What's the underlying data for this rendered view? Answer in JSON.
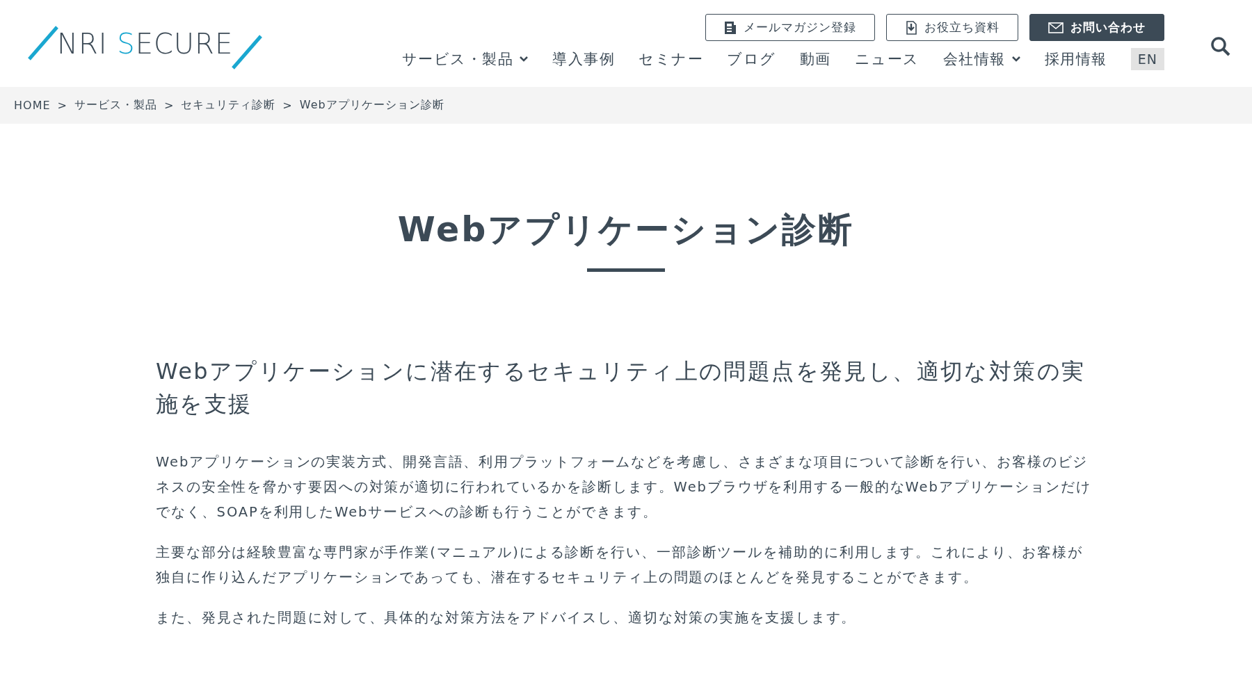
{
  "logo": {
    "parts": [
      {
        "text": "NRI ",
        "accent": false
      },
      {
        "text": "S",
        "accent": true
      },
      {
        "text": "ECURE",
        "accent": false
      }
    ]
  },
  "top_buttons": [
    {
      "label": "メールマガジン登録",
      "kind": "outline"
    },
    {
      "label": "お役立ち資料",
      "kind": "outline"
    },
    {
      "label": "お問い合わせ",
      "kind": "filled"
    }
  ],
  "nav": [
    {
      "label": "サービス・製品",
      "has_menu": true,
      "kind": "link"
    },
    {
      "label": "導入事例",
      "has_menu": false,
      "kind": "link"
    },
    {
      "label": "セミナー",
      "has_menu": false,
      "kind": "link"
    },
    {
      "label": "ブログ",
      "has_menu": false,
      "kind": "link"
    },
    {
      "label": "動画",
      "has_menu": false,
      "kind": "link"
    },
    {
      "label": "ニュース",
      "has_menu": false,
      "kind": "link"
    },
    {
      "label": "会社情報",
      "has_menu": true,
      "kind": "link"
    },
    {
      "label": "採用情報",
      "has_menu": false,
      "kind": "link"
    }
  ],
  "language": {
    "label": "EN"
  },
  "breadcrumb": {
    "links": [
      {
        "label": "HOME",
        "separator": ">"
      },
      {
        "label": "サービス・製品",
        "separator": ">"
      },
      {
        "label": "セキュリティ診断",
        "separator": ">"
      }
    ],
    "current": "Webアプリケーション診断"
  },
  "page_title": "Webアプリケーション診断",
  "lead": "Webアプリケーションに潜在するセキュリティ上の問題点を発見し、適切な対策の実施を支援",
  "paragraphs": [
    "Webアプリケーションの実装方式、開発言語、利用プラットフォームなどを考慮し、さまざまな項目について診断を行い、お客様のビジネスの安全性を脅かす要因への対策が適切に行われているかを診断します。Webブラウザを利用する一般的なWebアプリケーションだけでなく、SOAPを利用したWebサービスへの診断も行うことができます。",
    "主要な部分は経験豊富な専門家が手作業(マニュアル)による診断を行い、一部診断ツールを補助的に利用します。これにより、お客様が独自に作り込んだアプリケーションであっても、潜在するセキュリティ上の問題のほとんどを発見することができます。",
    "また、発見された問題に対して、具体的な対策方法をアドバイスし、適切な対策の実施を支援します。"
  ]
}
